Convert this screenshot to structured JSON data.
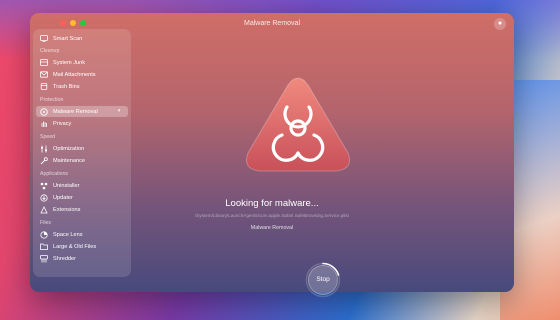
{
  "window": {
    "title": "Malware Removal"
  },
  "sidebar": {
    "smart_scan": "Smart Scan",
    "sections": {
      "cleanup": "Cleanup",
      "protection": "Protection",
      "speed": "Speed",
      "applications": "Applications",
      "files": "Files"
    },
    "items": {
      "system_junk": "System Junk",
      "mail_attachments": "Mail Attachments",
      "trash_bins": "Trash Bins",
      "malware_removal": "Malware Removal",
      "privacy": "Privacy",
      "optimization": "Optimization",
      "maintenance": "Maintenance",
      "uninstaller": "Uninstaller",
      "updater": "Updater",
      "extensions": "Extensions",
      "space_lens": "Space Lens",
      "large_old_files": "Large & Old Files",
      "shredder": "Shredder"
    },
    "active_item": "malware_removal"
  },
  "scan": {
    "heading": "Looking for malware...",
    "current_path": "/System/Library/LaunchAgents/com.apple.Safari.SafeBrowsing.Service.plist",
    "module": "Malware Removal"
  },
  "controls": {
    "stop_label": "Stop"
  },
  "icons": {
    "hero": "biohazard-icon",
    "assistant": "assistant-icon"
  },
  "colors": {
    "accent": "#e2605a",
    "window_top": "#d06e67",
    "window_bottom": "#474a7c"
  }
}
